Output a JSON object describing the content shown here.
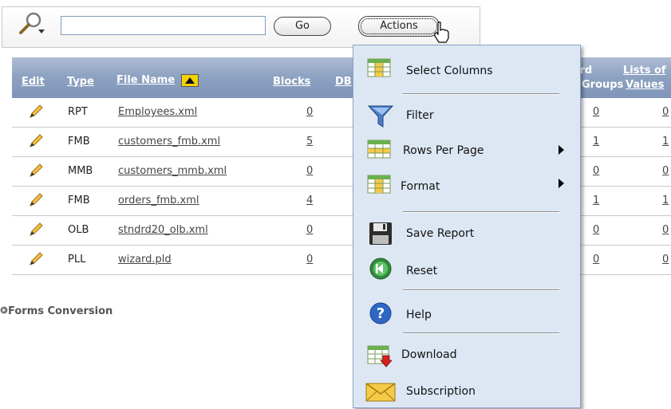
{
  "search": {
    "go_label": "Go",
    "actions_label": "Actions",
    "value": ""
  },
  "table": {
    "headers": {
      "edit": "Edit",
      "type": "Type",
      "file_name": "File Name",
      "blocks": "Blocks",
      "db": "DB",
      "record": "Record",
      "groups": "Groups",
      "lists_of": "Lists of",
      "values": "Values"
    },
    "rows": [
      {
        "type": "RPT",
        "file": "Employees.xml",
        "blocks": "0",
        "record_groups": "0",
        "lists_of_values": "0"
      },
      {
        "type": "FMB",
        "file": "customers_fmb.xml",
        "blocks": "5",
        "record_groups": "1",
        "lists_of_values": "1"
      },
      {
        "type": "MMB",
        "file": "customers_mmb.xml",
        "blocks": "0",
        "record_groups": "0",
        "lists_of_values": "0"
      },
      {
        "type": "FMB",
        "file": "orders_fmb.xml",
        "blocks": "4",
        "record_groups": "1",
        "lists_of_values": "1"
      },
      {
        "type": "OLB",
        "file": "stndrd20_olb.xml",
        "blocks": "0",
        "record_groups": "0",
        "lists_of_values": "0"
      },
      {
        "type": "PLL",
        "file": "wizard.pld",
        "blocks": "0",
        "record_groups": "0",
        "lists_of_values": "0"
      }
    ]
  },
  "section": {
    "forms_conversion": "Forms Conversion"
  },
  "menu": {
    "select_columns": "Select Columns",
    "filter": "Filter",
    "rows_per_page": "Rows Per Page",
    "format": "Format",
    "save_report": "Save Report",
    "reset": "Reset",
    "help": "Help",
    "download": "Download",
    "subscription": "Subscription"
  },
  "colors": {
    "header": "#8ea3c2",
    "menu_bg": "#dde7f4",
    "menu_border": "#8ca3c7"
  }
}
